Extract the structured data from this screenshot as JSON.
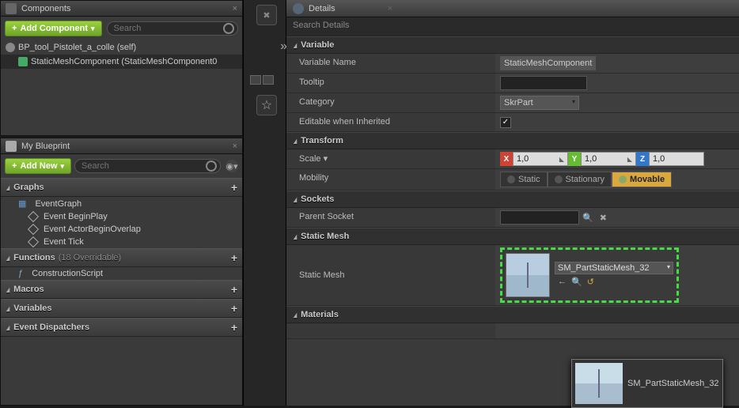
{
  "left": {
    "components_tab": "Components",
    "add_component": "Add Component",
    "search_placeholder": "Search",
    "root_item": "BP_tool_Pistolet_a_colle (self)",
    "child_item": "StaticMeshComponent (StaticMeshComponent0",
    "myblueprint_tab": "My Blueprint",
    "add_new": "Add New",
    "graphs": "Graphs",
    "eventgraph": "EventGraph",
    "events": [
      "Event BeginPlay",
      "Event ActorBeginOverlap",
      "Event Tick"
    ],
    "functions": "Functions",
    "functions_info": "(18 Overridable)",
    "construction": "ConstructionScript",
    "macros": "Macros",
    "variables": "Variables",
    "dispatchers": "Event Dispatchers"
  },
  "right": {
    "details_tab": "Details",
    "search_placeholder": "Search Details",
    "cat_variable": "Variable",
    "var_name_lbl": "Variable Name",
    "var_name_val": "StaticMeshComponent",
    "tooltip_lbl": "Tooltip",
    "category_lbl": "Category",
    "category_val": "SkrPart",
    "editable_lbl": "Editable when Inherited",
    "cat_transform": "Transform",
    "scale_lbl": "Scale",
    "scale_x": "1,0",
    "scale_y": "1,0",
    "scale_z": "1,0",
    "mobility_lbl": "Mobility",
    "mob_static": "Static",
    "mob_stationary": "Stationary",
    "mob_movable": "Movable",
    "cat_sockets": "Sockets",
    "parent_socket_lbl": "Parent Socket",
    "cat_staticmesh": "Static Mesh",
    "staticmesh_lbl": "Static Mesh",
    "staticmesh_val": "SM_PartStaticMesh_32",
    "cat_materials": "Materials",
    "tooltip_text": "SM_PartStaticMesh_32"
  }
}
